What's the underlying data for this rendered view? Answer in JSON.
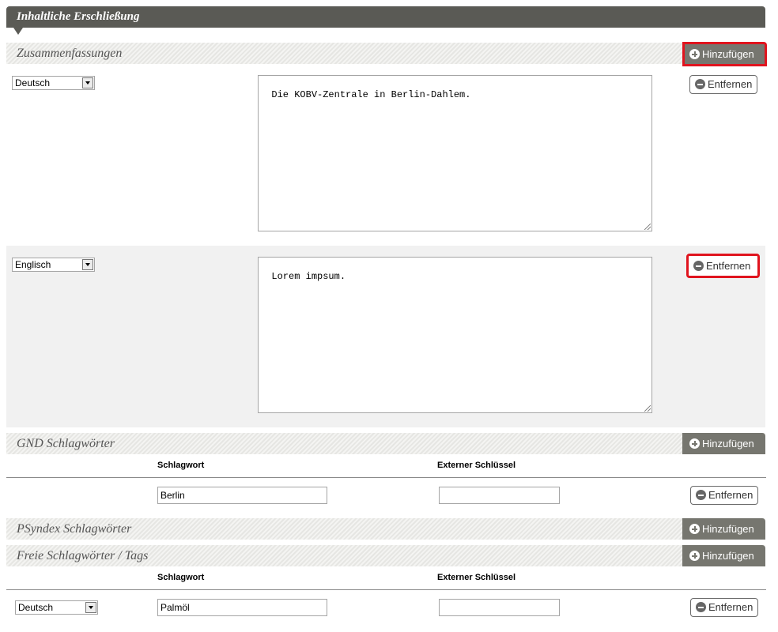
{
  "section_title": "Inhaltliche Erschließung",
  "buttons": {
    "add_label": "Hinzufügen",
    "remove_label": "Entfernen"
  },
  "summaries": {
    "title": "Zusammenfassungen",
    "entries": [
      {
        "language": "Deutsch",
        "text": "Die KOBV-Zentrale in Berlin-Dahlem."
      },
      {
        "language": "Englisch",
        "text": "Lorem impsum."
      }
    ]
  },
  "gnd": {
    "title": "GND Schlagwörter",
    "col_keyword": "Schlagwort",
    "col_external_key": "Externer Schlüssel",
    "rows": [
      {
        "keyword": "Berlin",
        "external_key": ""
      }
    ]
  },
  "psyndex": {
    "title": "PSyndex Schlagwörter"
  },
  "free": {
    "title": "Freie Schlagwörter / Tags",
    "col_keyword": "Schlagwort",
    "col_external_key": "Externer Schlüssel",
    "rows": [
      {
        "language": "Deutsch",
        "keyword": "Palmöl",
        "external_key": ""
      }
    ]
  },
  "colors": {
    "title_bar": "#5a5a55",
    "add_button": "#76766f",
    "highlight": "#e0141e",
    "grey_row": "#f1f1f1"
  },
  "icons": [
    "plus-circle-icon",
    "minus-circle-icon",
    "chevron-down-icon",
    "resize-grip-icon"
  ]
}
